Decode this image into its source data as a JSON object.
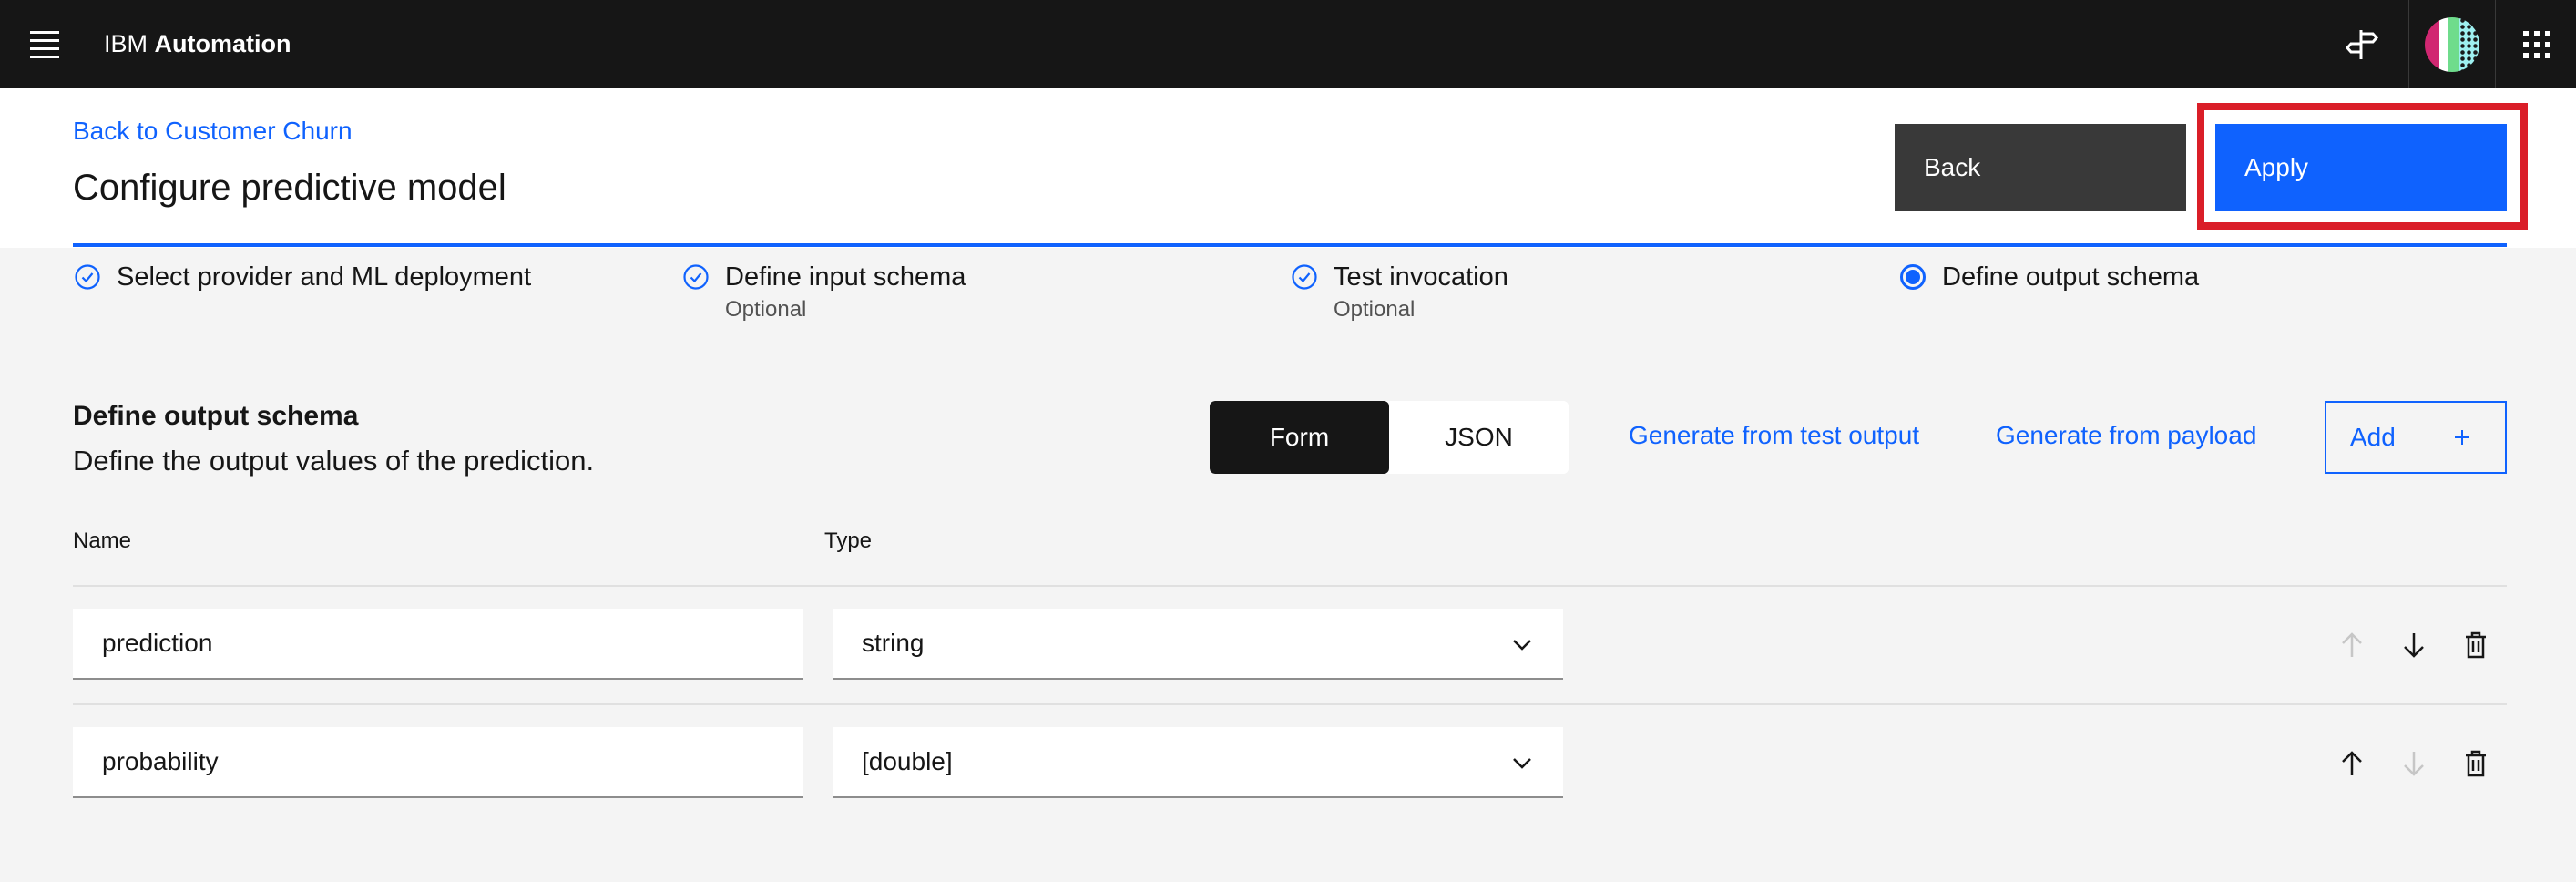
{
  "header": {
    "brand_prefix": "IBM",
    "brand_name": "Automation"
  },
  "page": {
    "back_link": "Back to Customer Churn",
    "title": "Configure predictive model",
    "back_button": "Back",
    "apply_button": "Apply"
  },
  "steps": [
    {
      "label": "Select provider and ML deployment",
      "status": "complete"
    },
    {
      "label": "Define input schema",
      "sub": "Optional",
      "status": "complete"
    },
    {
      "label": "Test invocation",
      "sub": "Optional",
      "status": "complete"
    },
    {
      "label": "Define output schema",
      "status": "current"
    }
  ],
  "section": {
    "title": "Define output schema",
    "description": "Define the output values of the prediction.",
    "toggle": [
      "Form",
      "JSON"
    ],
    "link_test_output": "Generate from test output",
    "link_payload": "Generate from payload",
    "add_button": "Add"
  },
  "table": {
    "headers": [
      "Name",
      "Type"
    ],
    "rows": [
      {
        "name": "prediction",
        "type": "string"
      },
      {
        "name": "probability",
        "type": "[double]"
      }
    ]
  },
  "colors": {
    "accent": "#0f62fe",
    "highlight": "#da1e28",
    "header_bg": "#161616"
  }
}
